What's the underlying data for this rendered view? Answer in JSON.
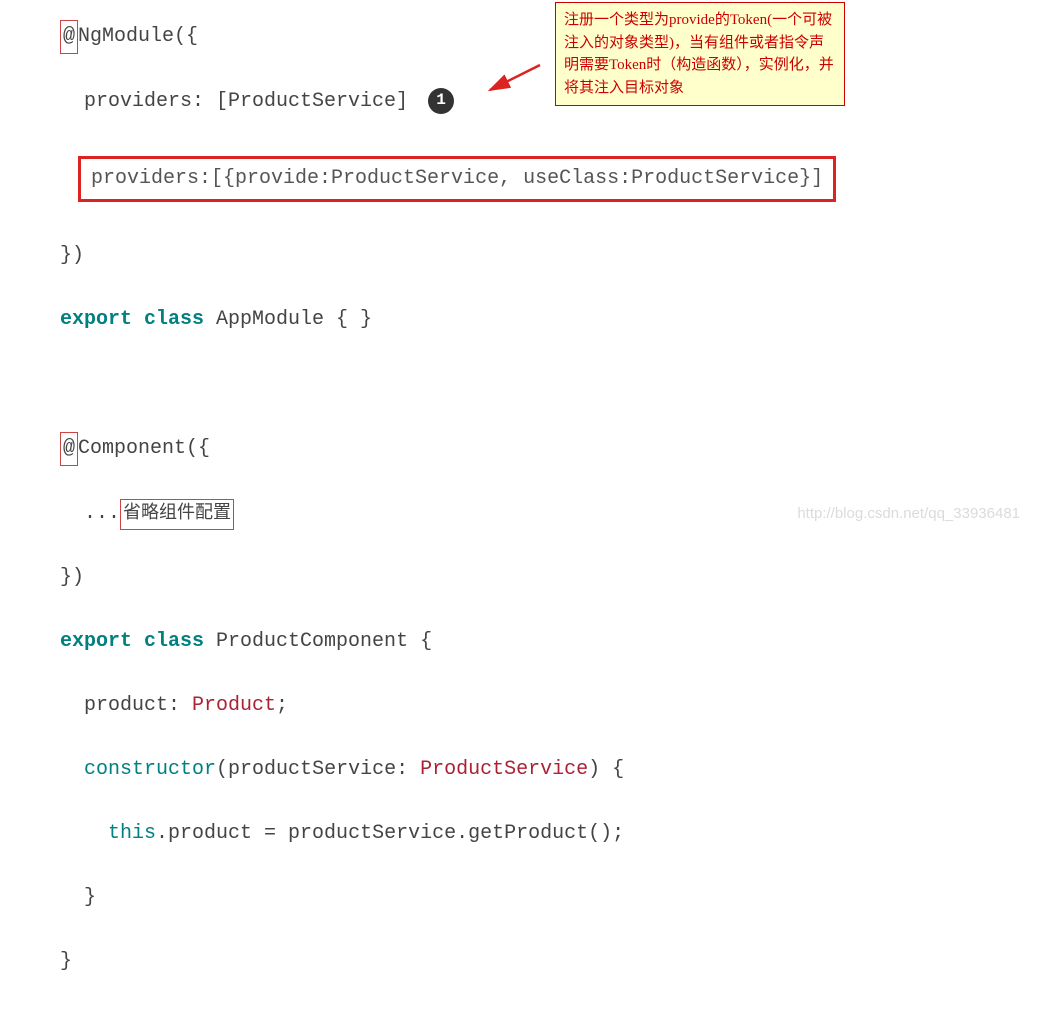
{
  "note": "注册一个类型为provide的Token(一个可被注入的对象类型)，当有组件或者指令声明需要Token时（构造函数），实例化，并将其注入目标对象",
  "badge_num": "1",
  "code": {
    "l1a": "@",
    "l1b": "NgModule",
    "l1c": "({",
    "l2a": "  providers: [ProductService]",
    "expanded": "providers:[{provide:ProductService, useClass:ProductService}]",
    "l3": "})",
    "l4a": "export class",
    "l4b": " AppModule { }",
    "l6a": "@",
    "l6b": "Component",
    "l6c": "({",
    "l7a": "  ...",
    "l7b": "省略组件配置",
    "l8": "})",
    "l9a": "export class",
    "l9b": " ProductComponent {",
    "l10a": "  product: ",
    "l10b": "Product",
    "l10c": ";",
    "l11a": "  ",
    "l11b": "constructor",
    "l11c": "(productService: ",
    "l11d": "ProductService",
    "l11e": ") {",
    "l12a": "    ",
    "l12b": "this",
    "l12c": ".product = productService.getProduct();",
    "l13": "  }",
    "l14": "}"
  },
  "watermark": "http://blog.csdn.net/qq_33936481"
}
